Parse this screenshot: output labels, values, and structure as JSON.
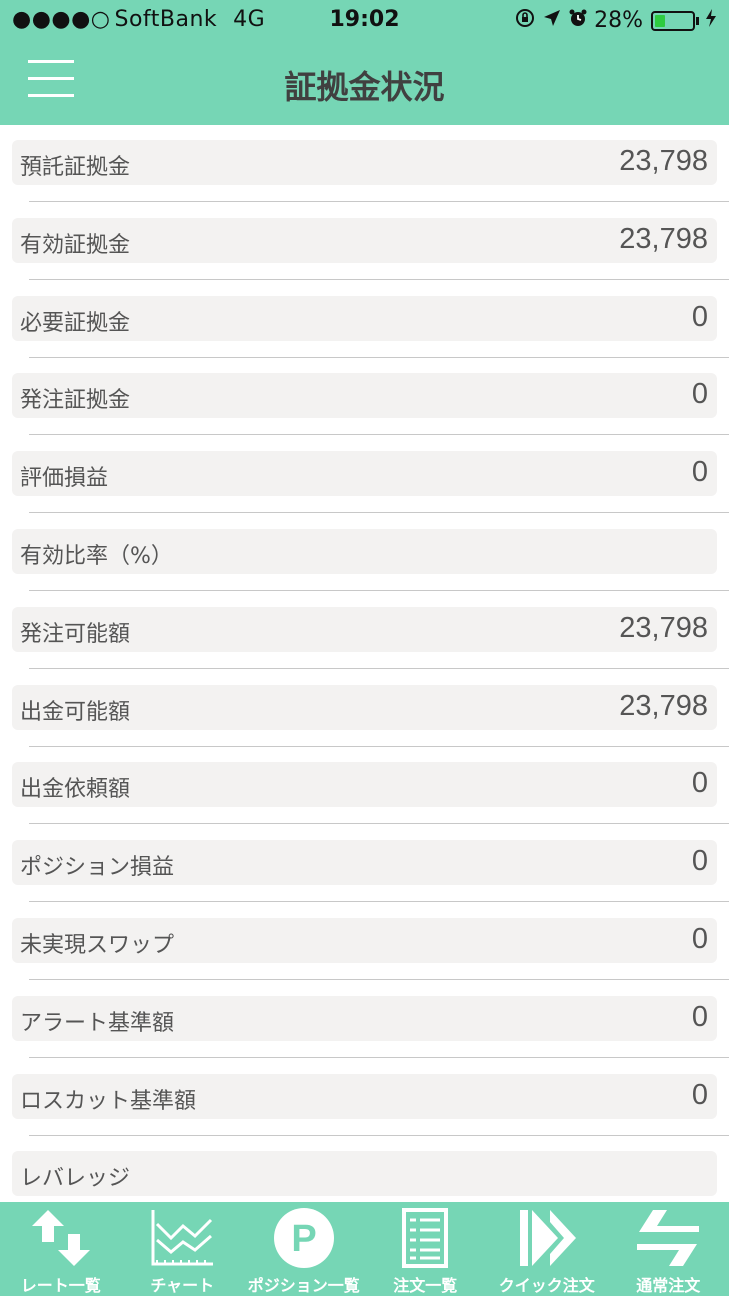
{
  "status_bar": {
    "signal": "●●●●○",
    "carrier": "SoftBank",
    "network": "4G",
    "time": "19:02",
    "battery_percent": "28%",
    "battery_level": 0.28,
    "icons": [
      "orientation-lock-icon",
      "location-arrow-icon",
      "alarm-icon",
      "battery-icon",
      "charging-bolt-icon"
    ]
  },
  "header": {
    "title": "証拠金状況",
    "menu_icon": "hamburger-menu-icon"
  },
  "rows": [
    {
      "label": "預託証拠金",
      "value": "23,798"
    },
    {
      "label": "有効証拠金",
      "value": "23,798"
    },
    {
      "label": "必要証拠金",
      "value": "0"
    },
    {
      "label": "発注証拠金",
      "value": "0"
    },
    {
      "label": "評価損益",
      "value": "0"
    },
    {
      "label": "有効比率（%）",
      "value": ""
    },
    {
      "label": "発注可能額",
      "value": "23,798"
    },
    {
      "label": "出金可能額",
      "value": "23,798"
    },
    {
      "label": "出金依頼額",
      "value": "0"
    },
    {
      "label": "ポジション損益",
      "value": "0"
    },
    {
      "label": "未実現スワップ",
      "value": "0"
    },
    {
      "label": "アラート基準額",
      "value": "0"
    },
    {
      "label": "ロスカット基準額",
      "value": "0"
    },
    {
      "label": "レバレッジ",
      "value": ""
    }
  ],
  "tabbar": {
    "tabs": [
      {
        "label": "レート一覧",
        "icon": "rate-arrows-icon"
      },
      {
        "label": "チャート",
        "icon": "chart-icon"
      },
      {
        "label": "ポジション一覧",
        "icon": "position-p-icon"
      },
      {
        "label": "注文一覧",
        "icon": "order-list-icon"
      },
      {
        "label": "クイック注文",
        "icon": "quick-order-icon"
      },
      {
        "label": "通常注文",
        "icon": "normal-order-icon"
      }
    ]
  },
  "colors": {
    "accent": "#76d6b5",
    "row_bg": "#f3f2f1",
    "text": "#555555"
  }
}
